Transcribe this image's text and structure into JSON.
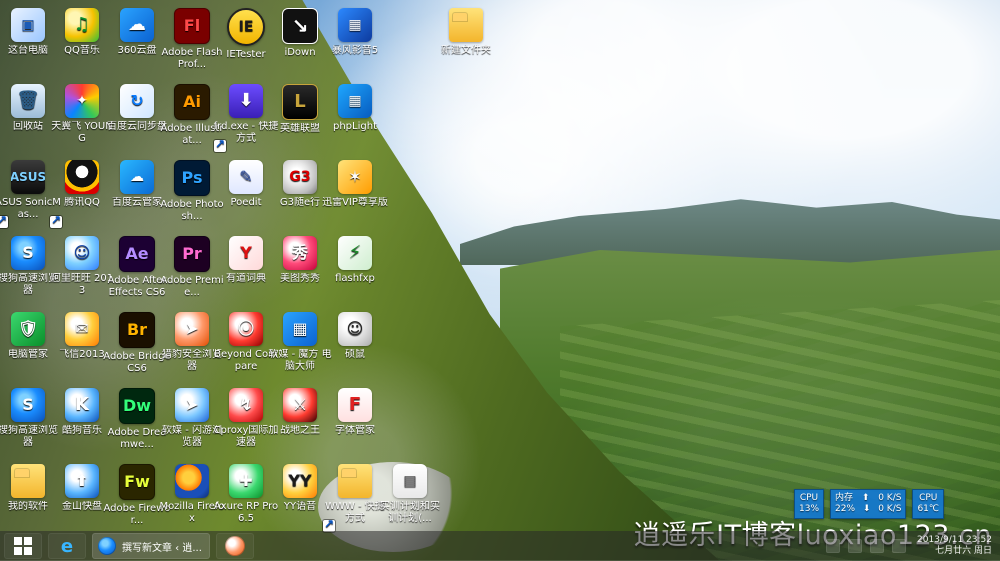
{
  "desktop": {
    "icons": [
      {
        "label": "这台电脑",
        "icon": "this-pc-icon"
      },
      {
        "label": "QQ音乐",
        "icon": "qq-music-icon"
      },
      {
        "label": "360云盘",
        "icon": "360-cloud-icon"
      },
      {
        "label": "Adobe Flash Prof...",
        "icon": "adobe-flash-icon"
      },
      {
        "label": "IETester",
        "icon": "ietester-icon"
      },
      {
        "label": "iDown",
        "icon": "idown-icon"
      },
      {
        "label": "暴风影音5",
        "icon": "storm-player-icon"
      },
      {
        "label": "新建文件夹",
        "icon": "folder-icon"
      },
      {
        "label": "回收站",
        "icon": "recycle-bin-icon"
      },
      {
        "label": "天翼飞 YOUNG",
        "icon": "tianyi-young-icon"
      },
      {
        "label": "百度云同步盘",
        "icon": "baidu-sync-icon"
      },
      {
        "label": "Adobe Illustrat...",
        "icon": "adobe-illustrator-icon"
      },
      {
        "label": "frd.exe - 快捷方式",
        "icon": "frd-exe-icon"
      },
      {
        "label": "英雄联盟",
        "icon": "league-of-legends-icon"
      },
      {
        "label": "phpLight",
        "icon": "phplight-icon"
      },
      {
        "label": "ASUS SonicMas...",
        "icon": "asus-sonicmaster-icon"
      },
      {
        "label": "腾讯QQ",
        "icon": "tencent-qq-icon"
      },
      {
        "label": "百度云管家",
        "icon": "baidu-cloud-manager-icon"
      },
      {
        "label": "Adobe Photosh...",
        "icon": "adobe-photoshop-icon"
      },
      {
        "label": "Poedit",
        "icon": "poedit-icon"
      },
      {
        "label": "G3随e行",
        "icon": "g3-icon"
      },
      {
        "label": "迅雷VIP尊享版",
        "icon": "thunder-vip-icon"
      },
      {
        "label": "搜狗高速浏览器",
        "icon": "sogou-browser-icon"
      },
      {
        "label": "阿里旺旺 2013",
        "icon": "aliwangwang-icon"
      },
      {
        "label": "Adobe After Effects CS6",
        "icon": "adobe-after-effects-icon"
      },
      {
        "label": "Adobe Premie...",
        "icon": "adobe-premiere-icon"
      },
      {
        "label": "有道词典",
        "icon": "youdao-dict-icon"
      },
      {
        "label": "美图秀秀",
        "icon": "meitu-icon"
      },
      {
        "label": "flashfxp",
        "icon": "flashfxp-icon"
      },
      {
        "label": "电脑管家",
        "icon": "pc-manager-icon"
      },
      {
        "label": "飞信2013",
        "icon": "fetion-icon"
      },
      {
        "label": "Adobe Bridge CS6",
        "icon": "adobe-bridge-icon"
      },
      {
        "label": "猎豹安全浏览器",
        "icon": "liebao-browser-icon"
      },
      {
        "label": "Beyond Compare",
        "icon": "beyond-compare-icon"
      },
      {
        "label": "软媒 - 魔方 电脑大师",
        "icon": "ruanmei-mofang-icon"
      },
      {
        "label": "硕鼠",
        "icon": "shuoshu-icon"
      },
      {
        "label": "搜狗高速浏览器",
        "icon": "sogou-browser-icon"
      },
      {
        "label": "酷狗音乐",
        "icon": "kugou-icon"
      },
      {
        "label": "Adobe Dreamwe...",
        "icon": "adobe-dreamweaver-icon"
      },
      {
        "label": "软媒 - 闪游浏览器",
        "icon": "ruanmei-flash-browser-icon"
      },
      {
        "label": "Cproxy国际加速器",
        "icon": "cproxy-icon"
      },
      {
        "label": "战地之王",
        "icon": "battlefield-icon"
      },
      {
        "label": "字体管家",
        "icon": "font-manager-icon"
      },
      {
        "label": "我的软件",
        "icon": "my-software-icon"
      },
      {
        "label": "金山快盘",
        "icon": "kingsoft-kuaipan-icon"
      },
      {
        "label": "Adobe Firewor...",
        "icon": "adobe-fireworks-icon"
      },
      {
        "label": "Mozilla Firefox",
        "icon": "firefox-icon"
      },
      {
        "label": "Axure RP Pro 6.5",
        "icon": "axure-icon"
      },
      {
        "label": "YY语音",
        "icon": "yy-voice-icon"
      },
      {
        "label": "WWW - 快捷方式",
        "icon": "www-shortcut-icon"
      },
      {
        "label": "实训计划和实训计划(...",
        "icon": "document-icon"
      }
    ]
  },
  "sensor": {
    "cpu_label": "CPU",
    "cpu_value": "13%",
    "mem_label": "内存",
    "mem_value": "22%",
    "up_value": "0 K/S",
    "down_value": "0 K/S",
    "cpu2_label": "CPU",
    "temp_value": "61℃"
  },
  "watermark": {
    "text": "逍遥乐IT博客luoxiao123.cn"
  },
  "taskbar": {
    "active_window_title": "撰写新文章 ‹ 逍...",
    "clock_time": "2013/9/11 23:52",
    "clock_date": "七月廿六 周日"
  }
}
